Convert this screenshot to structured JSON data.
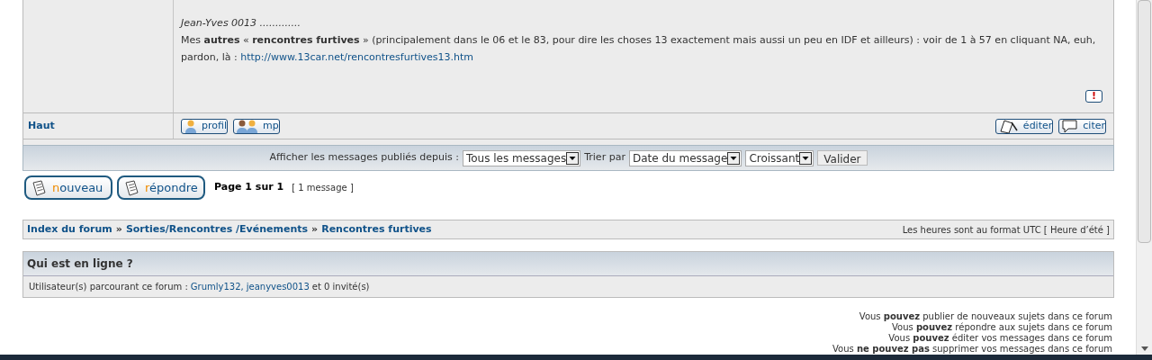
{
  "post": {
    "signature_title": "Jean-Yves 0013 .............",
    "body_text": "Mes **autres** « **rencontres furtives** » (principalement dans le 06 et le 83, pour dire les choses 13 exactement mais aussi un peu en IDF et ailleurs) : voir de 1 à 57 en cliquant NA, euh, pardon, là :",
    "body_link": "http://www.13car.net/rencontresfurtives13.htm",
    "report_icon": "!"
  },
  "post_footer": {
    "top_link": "Haut",
    "left_buttons": [
      {
        "kind": "profile",
        "label": "profil"
      },
      {
        "kind": "pm",
        "label": "mp"
      }
    ],
    "right_buttons": [
      {
        "kind": "edit",
        "label": "éditer"
      },
      {
        "kind": "quote",
        "label": "citer"
      }
    ]
  },
  "sort_bar": {
    "since_label": "Afficher les messages publiés depuis :",
    "since_value": "Tous les messages",
    "sort_label": "Trier par",
    "sort_value": "Date du message",
    "order_value": "Croissant",
    "submit": "Valider"
  },
  "actions": {
    "buttons": [
      {
        "label": "nouveau"
      },
      {
        "label": "répondre"
      }
    ],
    "page": "Page **1** sur **1**",
    "count": "[ 1 message ]"
  },
  "breadcrumb": {
    "items": [
      "Index du forum",
      "Sorties/Rencontres /Evénements",
      "Rencontres furtives"
    ],
    "separator": "»",
    "timezone": "Les heures sont au format UTC [ Heure d’été ]"
  },
  "online": {
    "title": "Qui est en ligne ?",
    "prefix": "Utilisateur(s) parcourant ce forum :",
    "users": [
      "Grumly132,",
      "jeanyves0013"
    ],
    "suffix": "et 0 invité(s)"
  },
  "permissions": [
    "Vous **pouvez** publier de nouveaux sujets dans ce forum",
    "Vous **pouvez** répondre aux sujets dans ce forum",
    "Vous **pouvez** éditer vos messages dans ce forum",
    "Vous **ne pouvez pas** supprimer vos messages dans ce forum"
  ]
}
